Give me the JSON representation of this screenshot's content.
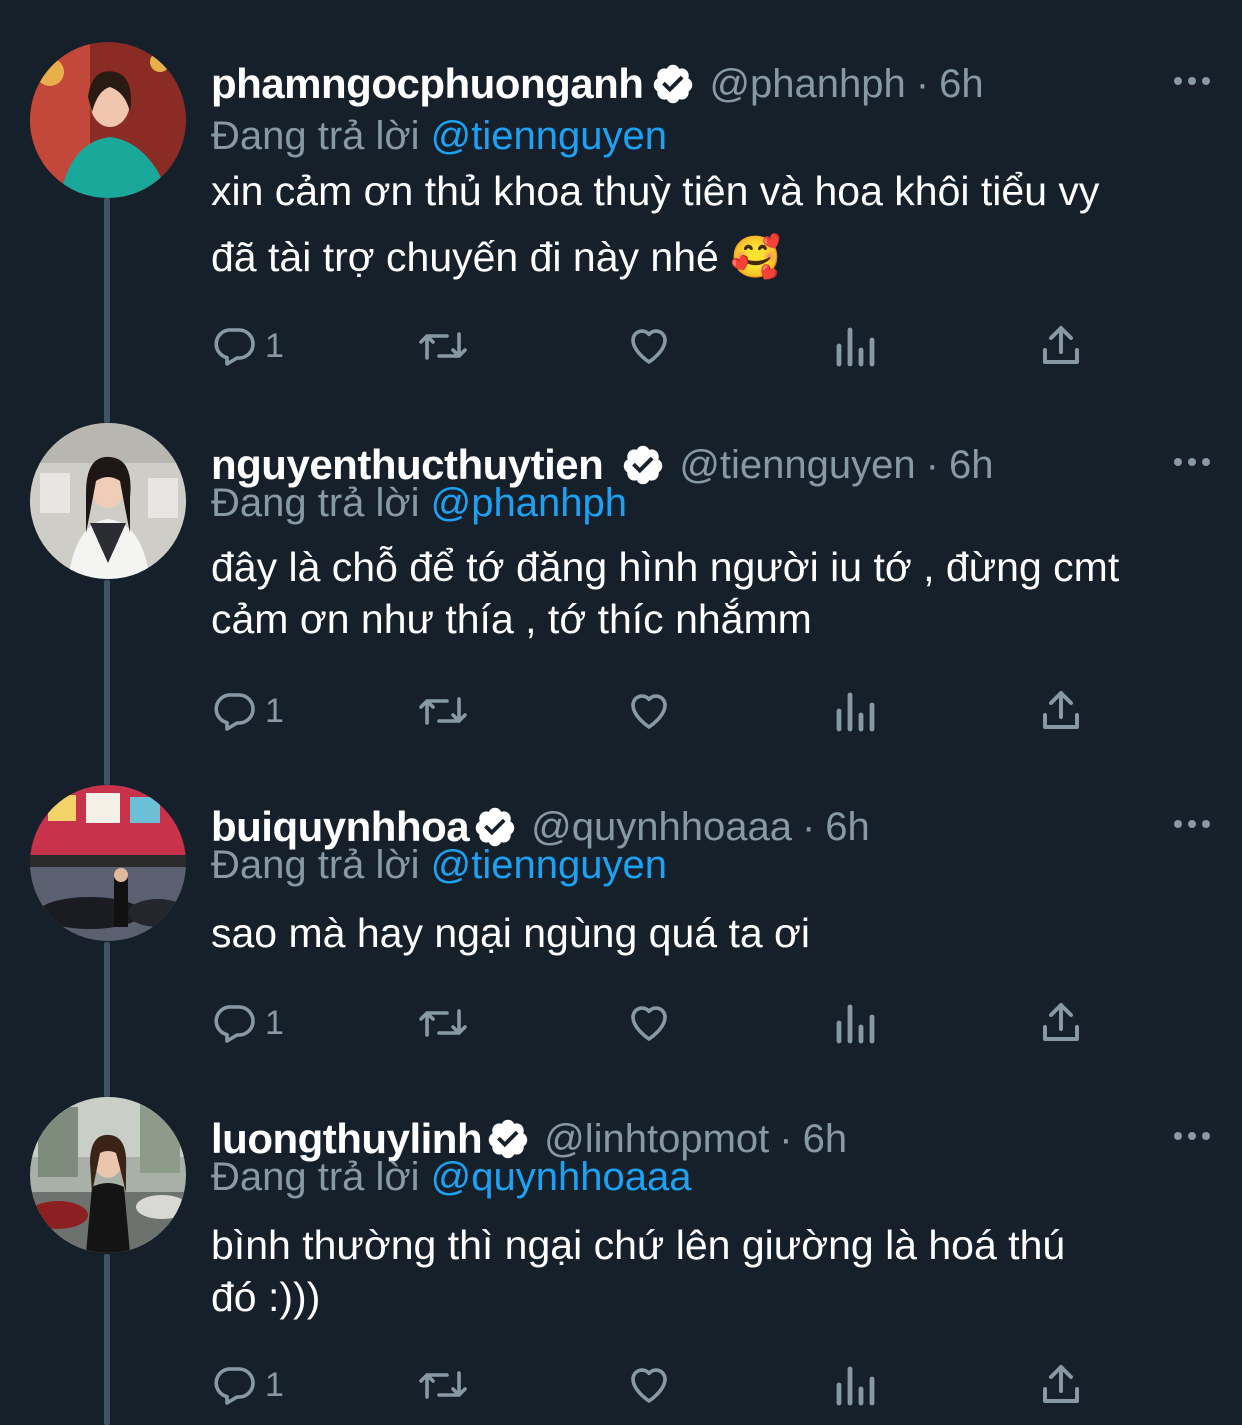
{
  "tweets": [
    {
      "display_name": "phamngocphuonganh",
      "handle": "@phanhph",
      "separator": "·",
      "time": "6h",
      "reply_prefix": "Đang trả lời",
      "reply_to": "@tiennguyen",
      "text_lines": [
        "xin cảm ơn thủ khoa thuỳ tiên và hoa khôi tiểu vy",
        "đã tài trợ chuyến đi này nhé 🥰"
      ],
      "reply_count": "1",
      "avatar_colors": [
        "#c4483a",
        "#1aa89a"
      ]
    },
    {
      "display_name": "nguyenthucthuytien",
      "handle": "@tiennguyen",
      "separator": "·",
      "time": "6h",
      "reply_prefix": "Đang trả lời",
      "reply_to": "@phanhph",
      "text_lines": [
        "đây là chỗ để tớ đăng hình người iu tớ , đừng cmt",
        "cảm ơn như thía , tớ thíc nhắmm"
      ],
      "reply_count": "1",
      "avatar_colors": [
        "#d7d6d2",
        "#f2f2f2"
      ]
    },
    {
      "display_name": "buiquynhhoa",
      "handle": "@quynhhoaaa",
      "separator": "·",
      "time": "6h",
      "reply_prefix": "Đang trả lời",
      "reply_to": "@tiennguyen",
      "text_lines": [
        "sao mà hay ngại ngùng quá ta ơi"
      ],
      "reply_count": "1",
      "avatar_colors": [
        "#c8324a",
        "#2b2f3a"
      ]
    },
    {
      "display_name": "luongthuylinh",
      "handle": "@linhtopmot",
      "separator": "·",
      "time": "6h",
      "reply_prefix": "Đang trả lời",
      "reply_to": "@quynhhoaaa",
      "text_lines": [
        "bình thường thì ngại chứ lên giường là hoá thú",
        "đó :)))"
      ],
      "reply_count": "1",
      "avatar_colors": [
        "#9aa39c",
        "#1c1c1c"
      ]
    }
  ],
  "icons": {
    "more": "more-horizontal-icon",
    "verified": "verified-badge-icon",
    "reply": "reply-icon",
    "retweet": "retweet-icon",
    "like": "heart-icon",
    "analytics": "analytics-icon",
    "share": "share-icon"
  },
  "colors": {
    "background": "#15202b",
    "text_secondary": "#8899a6",
    "accent": "#1da1f2",
    "thread_line": "#3d5466"
  }
}
